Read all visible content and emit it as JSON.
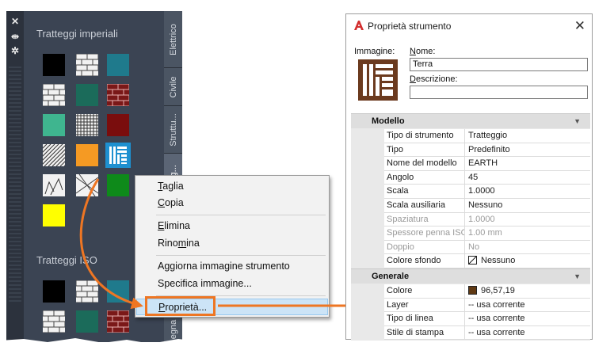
{
  "palette": {
    "controls": [
      "close-icon",
      "pin-icon",
      "settings-icon"
    ],
    "sections": [
      {
        "title": "Tratteggi imperiali"
      },
      {
        "title": "Tratteggi ISO"
      }
    ],
    "tabs": [
      {
        "label": "Elettrico"
      },
      {
        "label": "Civile"
      },
      {
        "label": "Struttu..."
      },
      {
        "label": "Tratteg..."
      },
      {
        "label": "egna"
      }
    ],
    "swatches_imperial": [
      {
        "kind": "solid",
        "color": "#000000"
      },
      {
        "kind": "hatch-brick",
        "color": "#f2f2f2"
      },
      {
        "kind": "solid",
        "color": "#1f7a8c"
      },
      {
        "kind": "hatch-brick",
        "color": "#f2f2f2"
      },
      {
        "kind": "solid",
        "color": "#1b6b5a"
      },
      {
        "kind": "hatch-brick",
        "color": "#7a1818"
      },
      {
        "kind": "solid",
        "color": "#3fb58f"
      },
      {
        "kind": "hatch-grid",
        "color": "#f2f2f2"
      },
      {
        "kind": "solid",
        "color": "#7a0d0d"
      },
      {
        "kind": "hatch-diag",
        "color": "#f2f2f2"
      },
      {
        "kind": "solid",
        "color": "#f59a23"
      },
      {
        "kind": "earth",
        "color": "#1e90d0"
      },
      {
        "kind": "hatch-rock",
        "color": "#f2f2f2"
      },
      {
        "kind": "hatch-cross",
        "color": "#f2f2f2"
      },
      {
        "kind": "solid",
        "color": "#0e8a1a"
      },
      {
        "kind": "solid",
        "color": "#ffff00"
      }
    ],
    "swatches_iso": [
      {
        "kind": "solid",
        "color": "#000000"
      },
      {
        "kind": "hatch-brick",
        "color": "#f2f2f2"
      },
      {
        "kind": "solid",
        "color": "#1f7a8c"
      },
      {
        "kind": "hatch-brick",
        "color": "#f2f2f2"
      },
      {
        "kind": "solid",
        "color": "#1b6b5a"
      },
      {
        "kind": "hatch-brick",
        "color": "#7a1818"
      }
    ]
  },
  "context_menu": {
    "items": [
      {
        "pre": "",
        "u": "T",
        "post": "aglia"
      },
      {
        "pre": "",
        "u": "C",
        "post": "opia"
      },
      {
        "pre": "",
        "u": "E",
        "post": "limina"
      },
      {
        "pre": "Rino",
        "u": "m",
        "post": "ina"
      },
      {
        "pre": "Aggiorna immagine strumento",
        "u": "",
        "post": ""
      },
      {
        "pre": "Specifica immagine...",
        "u": "",
        "post": ""
      },
      {
        "pre": "",
        "u": "P",
        "post": "roprietà..."
      }
    ]
  },
  "dialog": {
    "title": "Proprietà strumento",
    "image_label": "Immagine:",
    "name_label": {
      "u": "N",
      "post": "ome:"
    },
    "name_value": "Terra",
    "desc_label": {
      "u": "D",
      "post": "escrizione:"
    },
    "desc_value": "",
    "categories": [
      {
        "title": "Modello",
        "rows": [
          {
            "name": "Tipo di strumento",
            "value": "Tratteggio",
            "disabled": false
          },
          {
            "name": "Tipo",
            "value": "Predefinito",
            "disabled": false
          },
          {
            "name": "Nome del modello",
            "value": "EARTH",
            "disabled": false
          },
          {
            "name": "Angolo",
            "value": "45",
            "disabled": false
          },
          {
            "name": "Scala",
            "value": "1.0000",
            "disabled": false
          },
          {
            "name": "Scala ausiliaria",
            "value": "Nessuno",
            "disabled": false
          },
          {
            "name": "Spaziatura",
            "value": "1.0000",
            "disabled": true
          },
          {
            "name": "Spessore penna ISO",
            "value": "1.00 mm",
            "disabled": true
          },
          {
            "name": "Doppio",
            "value": "No",
            "disabled": true
          },
          {
            "name": "Colore sfondo",
            "value": "Nessuno",
            "disabled": false,
            "chip": "none"
          }
        ]
      },
      {
        "title": "Generale",
        "rows": [
          {
            "name": "Colore",
            "value": "96,57,19",
            "disabled": false,
            "chip": "#603913"
          },
          {
            "name": "Layer",
            "value": "-- usa corrente",
            "disabled": false
          },
          {
            "name": "Tipo di linea",
            "value": "-- usa corrente",
            "disabled": false
          },
          {
            "name": "Stile di stampa",
            "value": "-- usa corrente",
            "disabled": false
          }
        ]
      }
    ]
  },
  "colors": {
    "accent": "#ee7623",
    "highlight": "#1e90d0",
    "palette_bg": "#3b4453"
  }
}
